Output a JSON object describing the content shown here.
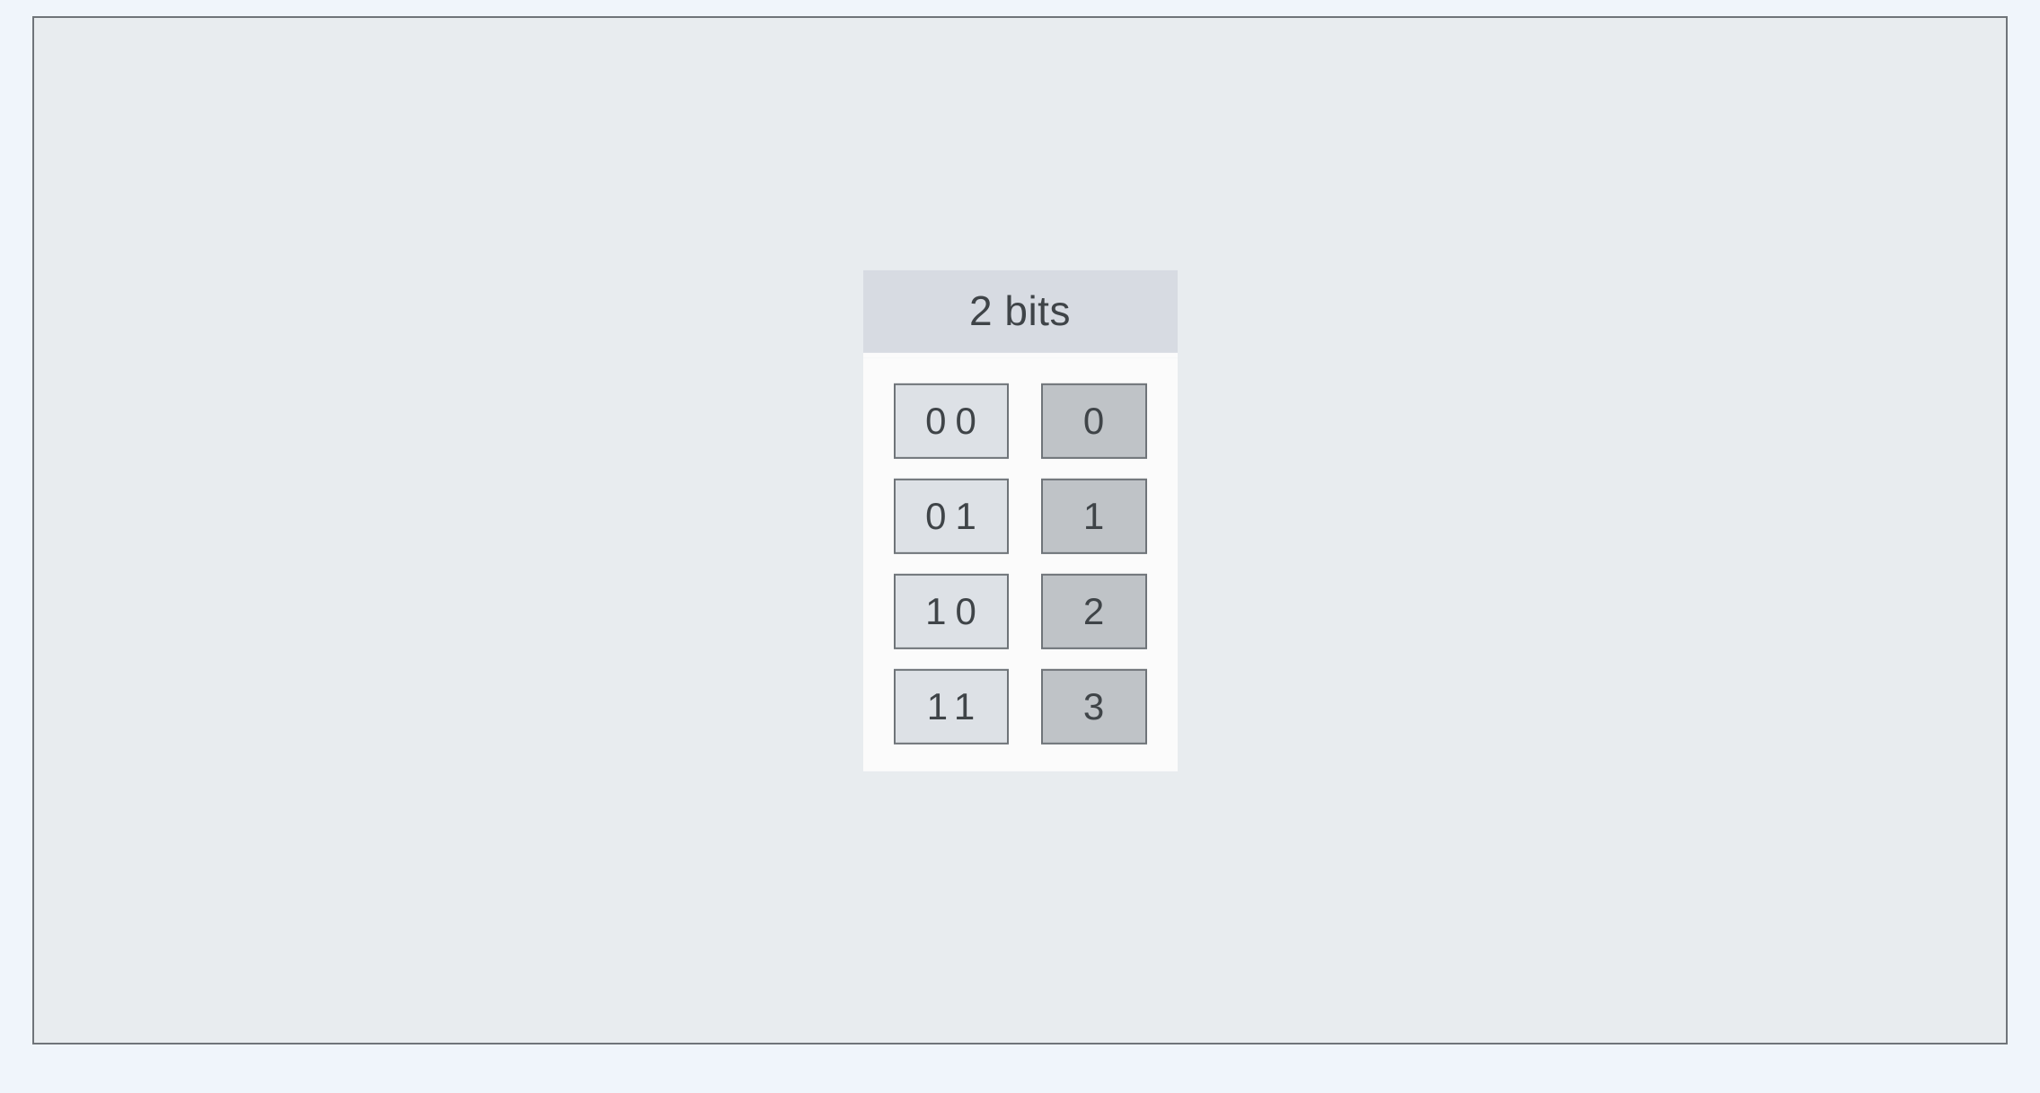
{
  "header": {
    "title": "2 bits"
  },
  "rows": [
    {
      "bits": "00",
      "dec": "0"
    },
    {
      "bits": "01",
      "dec": "1"
    },
    {
      "bits": "10",
      "dec": "2"
    },
    {
      "bits": "11",
      "dec": "3"
    }
  ]
}
